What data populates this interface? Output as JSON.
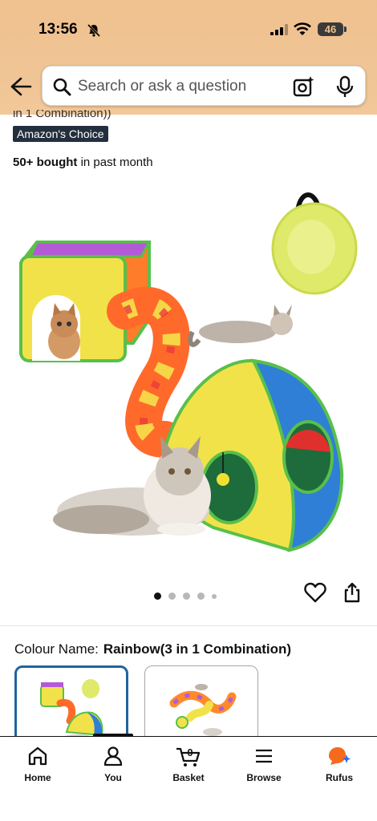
{
  "status_bar": {
    "time": "13:56",
    "battery": "46"
  },
  "search": {
    "placeholder": "Search or ask a question"
  },
  "product": {
    "title_fragment": "in 1 Combination))",
    "badge": "Amazon's Choice",
    "bought_bold": "50+ bought",
    "bought_rest": " in past month"
  },
  "gallery": {
    "image_count": 5,
    "active_index": 0
  },
  "variation": {
    "label": "Colour Name:",
    "value": "Rainbow(3 in 1 Combination)"
  },
  "bottom_nav": {
    "items": [
      {
        "label": "Home",
        "icon": "home-icon"
      },
      {
        "label": "You",
        "icon": "person-icon"
      },
      {
        "label": "Basket",
        "icon": "cart-icon",
        "count": "0"
      },
      {
        "label": "Browse",
        "icon": "menu-icon"
      },
      {
        "label": "Rufus",
        "icon": "rufus-icon"
      }
    ]
  },
  "colors": {
    "header": "#efc18f",
    "badge": "#232f3e",
    "selected_border": "#2162a1",
    "rufus": "#f56a1d"
  }
}
